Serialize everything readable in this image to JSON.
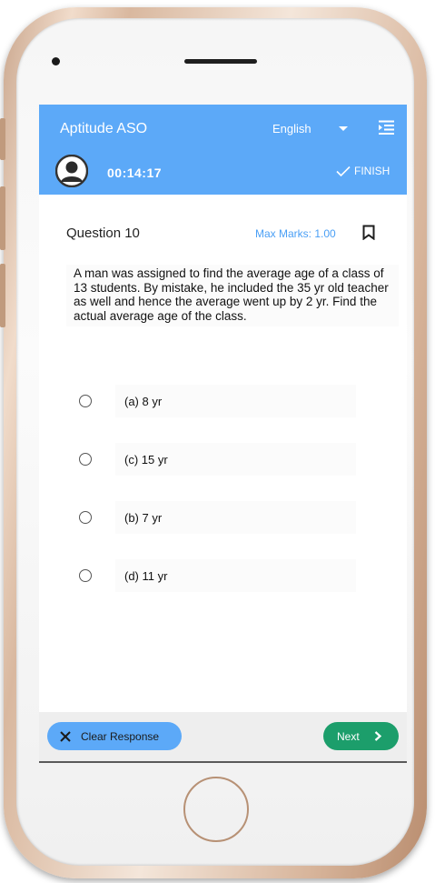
{
  "header": {
    "app_title": "Aptitude ASO",
    "language": "English",
    "timer": "00:14:17",
    "finish_label": "FINISH"
  },
  "question": {
    "title": "Question 10",
    "max_marks": "Max Marks: 1.00",
    "text": "A man was assigned to find the average age of a class of 13 students. By mistake, he included the 35 yr old teacher as well and hence the average went up by 2 yr. Find the actual average age of the class."
  },
  "options": [
    {
      "label": "(a) 8 yr",
      "selected": false
    },
    {
      "label": "(c) 15 yr",
      "selected": false
    },
    {
      "label": "(b) 7 yr",
      "selected": false
    },
    {
      "label": "(d) 11 yr",
      "selected": false
    }
  ],
  "footer": {
    "clear_label": "Clear Response",
    "next_label": "Next"
  },
  "colors": {
    "header_bg": "#5ca9f8",
    "max_marks": "#4a9ff5",
    "next_bg": "#1c9e6b",
    "clear_bg": "#5ca9f8"
  },
  "icons": {
    "menu": "menu-lines-icon",
    "avatar": "user-avatar-icon",
    "finish": "check-icon",
    "bookmark": "bookmark-icon",
    "clear": "close-icon",
    "next": "chevron-right-icon",
    "language": "caret-down-icon"
  }
}
